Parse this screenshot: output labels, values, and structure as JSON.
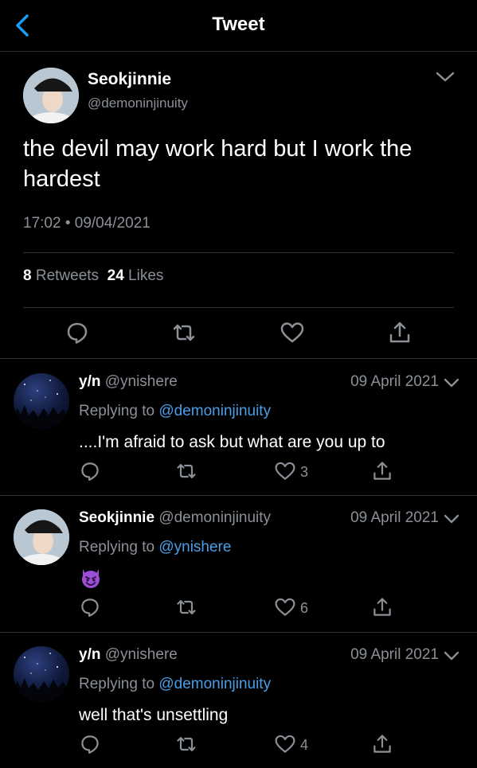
{
  "header": {
    "title": "Tweet"
  },
  "main_tweet": {
    "display_name": "Seokjinnie",
    "handle": "@demoninjinuity",
    "text": "the devil may work hard but I work the hardest",
    "timestamp": "17:02 • 09/04/2021",
    "retweets_count": "8",
    "retweets_label": "Retweets",
    "likes_count": "24",
    "likes_label": "Likes"
  },
  "replies": [
    {
      "display_name": "y/n",
      "handle": "@ynishere",
      "date": "09 April 2021",
      "replying_label": "Replying to",
      "replying_to": "@demoninjinuity",
      "text": "....I'm afraid to ask but what are you up to",
      "likes": "3",
      "avatar": "night-sky"
    },
    {
      "display_name": "Seokjinnie",
      "handle": "@demoninjinuity",
      "date": "09 April 2021",
      "replying_label": "Replying to",
      "replying_to": "@ynishere",
      "emoji": "smiling-imp",
      "likes": "6",
      "avatar": "person"
    },
    {
      "display_name": "y/n",
      "handle": "@ynishere",
      "date": "09 April 2021",
      "replying_label": "Replying to",
      "replying_to": "@demoninjinuity",
      "text": "well that's unsettling",
      "likes": "4",
      "avatar": "night-sky"
    }
  ],
  "colors": {
    "background": "#000000",
    "link": "#4a9ee8",
    "muted": "#8b9097",
    "accent": "#1d9bf0"
  }
}
